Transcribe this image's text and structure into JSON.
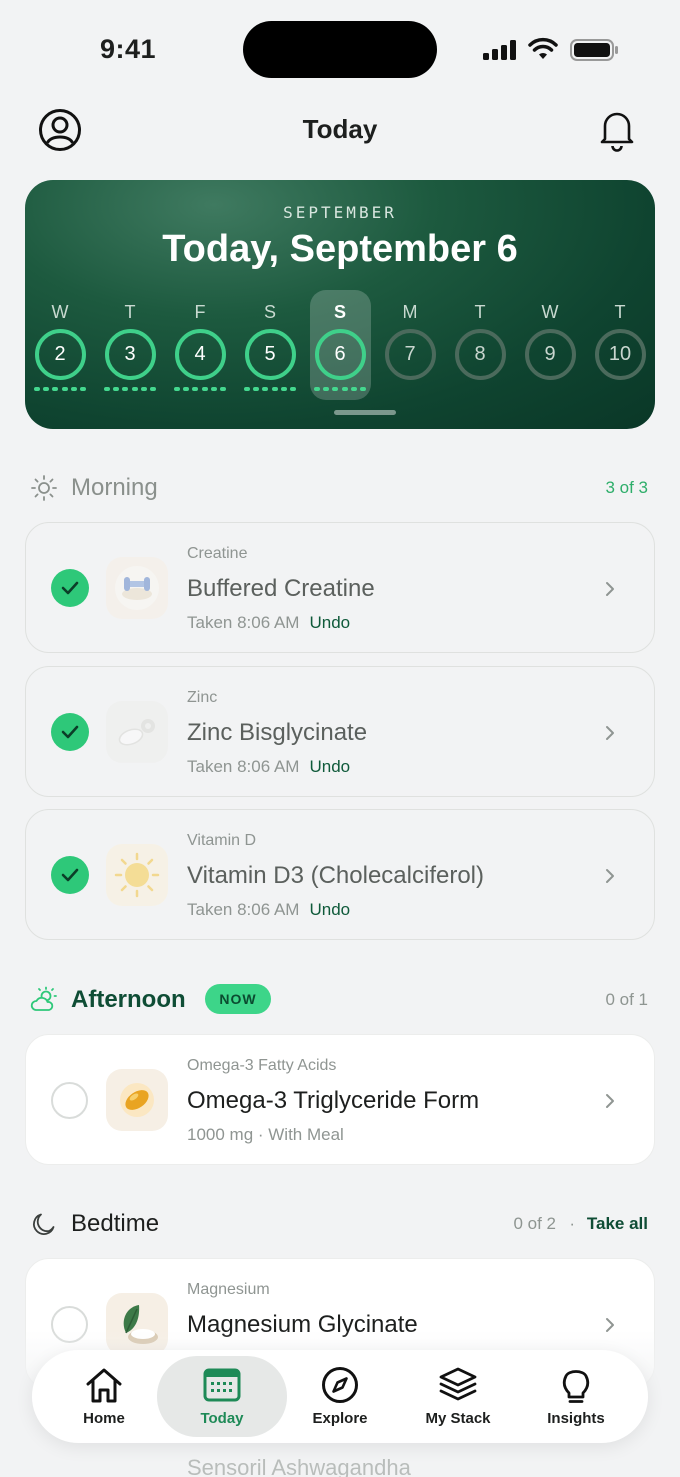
{
  "status_bar": {
    "time": "9:41"
  },
  "header": {
    "title": "Today"
  },
  "calendar": {
    "month": "SEPTEMBER",
    "title": "Today, September 6",
    "days": [
      {
        "letter": "W",
        "num": "2",
        "state": "done"
      },
      {
        "letter": "T",
        "num": "3",
        "state": "done"
      },
      {
        "letter": "F",
        "num": "4",
        "state": "done"
      },
      {
        "letter": "S",
        "num": "5",
        "state": "done"
      },
      {
        "letter": "S",
        "num": "6",
        "state": "selected"
      },
      {
        "letter": "M",
        "num": "7",
        "state": "future"
      },
      {
        "letter": "T",
        "num": "8",
        "state": "future"
      },
      {
        "letter": "W",
        "num": "9",
        "state": "future"
      },
      {
        "letter": "T",
        "num": "10",
        "state": "future"
      }
    ]
  },
  "morning": {
    "title": "Morning",
    "count": "3 of 3",
    "items": [
      {
        "category": "Creatine",
        "name": "Buffered Creatine",
        "meta": "Taken 8:06 AM",
        "action": "Undo"
      },
      {
        "category": "Zinc",
        "name": "Zinc Bisglycinate",
        "meta": "Taken 8:06 AM",
        "action": "Undo"
      },
      {
        "category": "Vitamin D",
        "name": "Vitamin D3 (Cholecalciferol)",
        "meta": "Taken 8:06 AM",
        "action": "Undo"
      }
    ]
  },
  "afternoon": {
    "title": "Afternoon",
    "badge": "NOW",
    "count": "0 of 1",
    "items": [
      {
        "category": "Omega-3 Fatty Acids",
        "name": "Omega-3 Triglyceride Form",
        "meta": "1000 mg · With Meal"
      }
    ]
  },
  "bedtime": {
    "title": "Bedtime",
    "count": "0 of 2",
    "separator": "·",
    "take_all": "Take all",
    "items": [
      {
        "category": "Magnesium",
        "name": "Magnesium Glycinate"
      },
      {
        "name": "Sensoril Ashwagandha"
      }
    ]
  },
  "nav": {
    "items": [
      {
        "label": "Home",
        "icon": "home-icon"
      },
      {
        "label": "Today",
        "icon": "calendar-icon",
        "selected": true
      },
      {
        "label": "Explore",
        "icon": "compass-icon"
      },
      {
        "label": "My Stack",
        "icon": "layers-icon"
      },
      {
        "label": "Insights",
        "icon": "lightbulb-icon"
      }
    ]
  },
  "colors": {
    "accent": "#2ec879",
    "brand_dark": "#0f4d35",
    "now_badge": "#3dd589"
  }
}
